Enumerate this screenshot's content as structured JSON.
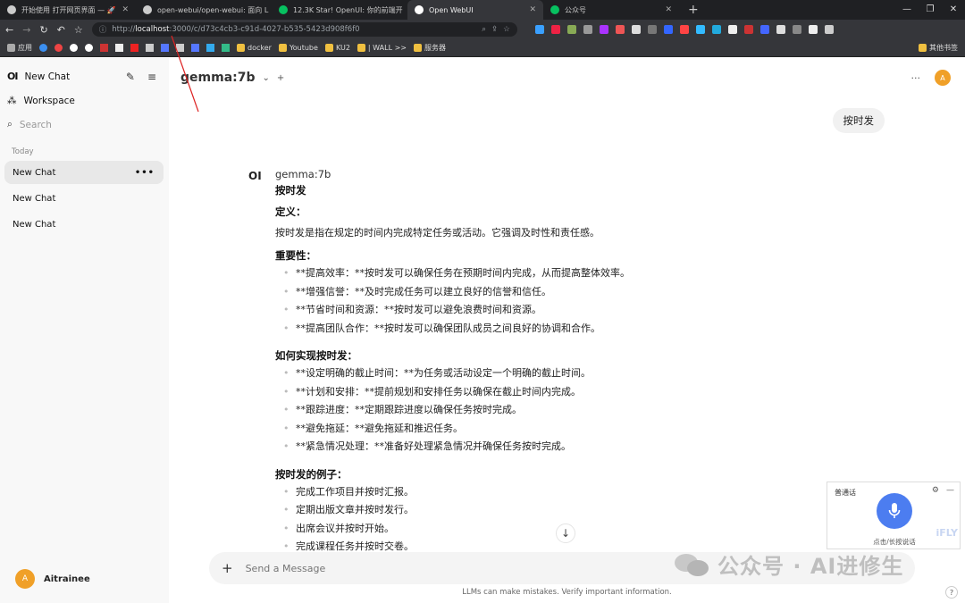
{
  "browser": {
    "tabs": [
      {
        "title": "开始使用 打开网页界面 — 🚀",
        "active": false
      },
      {
        "title": "open-webui/open-webui: 面向 L",
        "active": false
      },
      {
        "title": "12.3K Star! OpenUI: 你的前端开",
        "active": false
      },
      {
        "title": "Open WebUI",
        "active": true
      },
      {
        "title": "公众号",
        "active": false
      }
    ],
    "new_tab_label": "+",
    "url_prefix": "http://",
    "url_host": "localhost",
    "url_rest": ":3000/c/d73c4cb3-c91d-4027-b535-5423d908f6f0",
    "bookmarks": [
      "应用",
      "docker",
      "Youtube",
      "KU2",
      "| WALL >>",
      "服务器"
    ],
    "bookmarks_right": "其他书签",
    "win_controls": [
      "—",
      "❐",
      "✕"
    ],
    "accent_colors": {
      "omni_bg": "#202124",
      "chrome": "#35363a"
    }
  },
  "sidebar": {
    "logo": "OI",
    "new_chat_label": "New Chat",
    "workspace_label": "Workspace",
    "search_placeholder": "Search",
    "section_today": "Today",
    "chats": [
      "New Chat",
      "New Chat",
      "New Chat"
    ],
    "active_chat_dots": "•••",
    "user_name": "Aitrainee",
    "user_initial": "A"
  },
  "main": {
    "model_name": "gemma:7b",
    "model_add": "+",
    "more_label": "···",
    "user_initial": "A",
    "user_message": "按时发",
    "assistant": {
      "logo": "OI",
      "name": "gemma:7b",
      "title": "按时发",
      "def_heading": "定义：",
      "def_text": "按时发是指在规定的时间内完成特定任务或活动。它强调及时性和责任感。",
      "importance_heading": "重要性：",
      "importance_items": [
        "**提高效率：**按时发可以确保任务在预期时间内完成，从而提高整体效率。",
        "**增强信誉：**及时完成任务可以建立良好的信誉和信任。",
        "**节省时间和资源：**按时发可以避免浪费时间和资源。",
        "**提高团队合作：**按时发可以确保团队成员之间良好的协调和合作。"
      ],
      "howto_heading": "如何实现按时发：",
      "howto_items": [
        "**设定明确的截止时间：**为任务或活动设定一个明确的截止时间。",
        "**计划和安排：**提前规划和安排任务以确保在截止时间内完成。",
        "**跟踪进度：**定期跟踪进度以确保任务按时完成。",
        "**避免拖延：**避免拖延和推迟任务。",
        "**紧急情况处理：**准备好处理紧急情况并确保任务按时完成。"
      ],
      "examples_heading": "按时发的例子：",
      "examples_items": [
        "完成工作项目并按时汇报。",
        "定期出版文章并按时发行。",
        "出席会议并按时开始。",
        "完成课程任务并按时交卷。"
      ]
    },
    "scroll_down_icon": "↓",
    "composer_placeholder": "Send a Message",
    "composer_plus": "+",
    "disclaimer": "LLMs can make mistakes. Verify important information.",
    "help": "?"
  },
  "voice_widget": {
    "lang": "普通话",
    "hint": "点击/长按说话",
    "brand": "iFLY"
  },
  "watermark": {
    "text": "公众号 · AI进修生"
  }
}
